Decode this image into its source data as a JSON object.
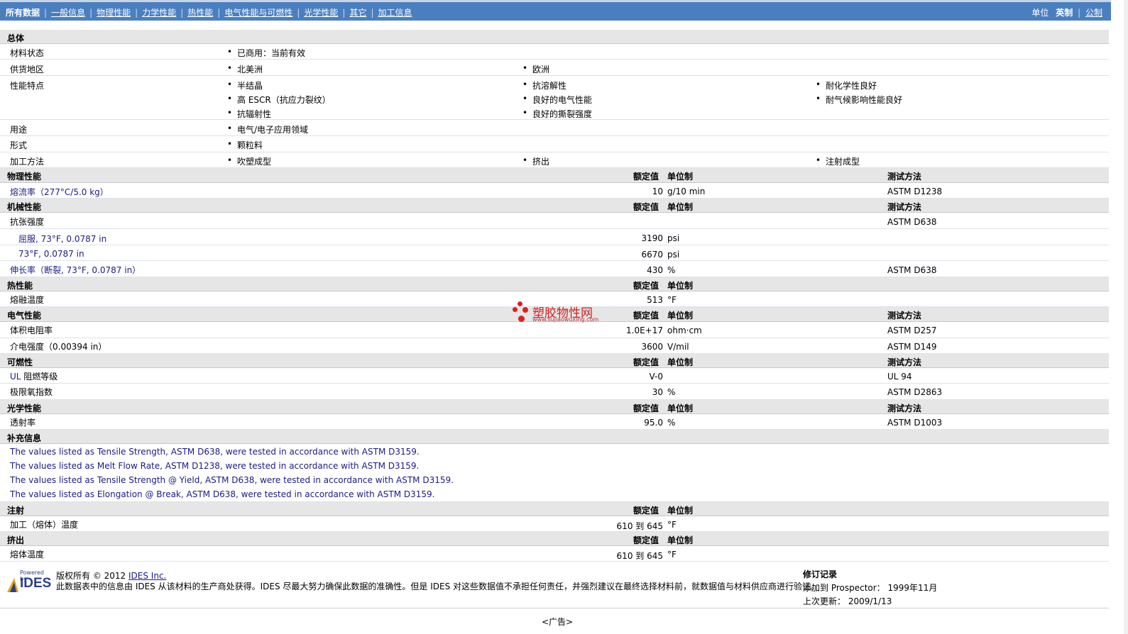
{
  "nav": {
    "tabs": [
      "所有数据",
      "一般信息",
      "物理性能",
      "力学性能",
      "热性能",
      "电气性能与可燃性",
      "光学性能",
      "其它",
      "加工信息"
    ],
    "units_label": "单位",
    "unit_english": "英制",
    "unit_metric": "公制"
  },
  "general": {
    "title": "总体",
    "status_label": "材料状态",
    "status_value": "已商用：当前有效",
    "region_label": "供货地区",
    "region_values": [
      "北美洲",
      "欧洲"
    ],
    "features_label": "性能特点",
    "features": [
      "半结晶",
      "抗溶解性",
      "耐化学性良好",
      "高 ESCR（抗应力裂纹）",
      "良好的电气性能",
      "耐气候影响性能良好",
      "抗辐射性",
      "良好的撕裂强度"
    ],
    "use_label": "用途",
    "use_value": "电气/电子应用领域",
    "form_label": "形式",
    "form_value": "颗粒料",
    "process_label": "加工方法",
    "process_values": [
      "吹塑成型",
      "挤出",
      "注射成型"
    ]
  },
  "headers": {
    "nominal": "额定值",
    "unit": "单位制",
    "method": "测试方法"
  },
  "physical": {
    "title": "物理性能",
    "rows": [
      {
        "label": "熔流率（277°C/5.0 kg）",
        "value": "10",
        "unit": "g/10 min",
        "method": "ASTM D1238"
      }
    ]
  },
  "mechanical": {
    "title": "机械性能",
    "tensile_label": "抗张强度",
    "tensile_method": "ASTM D638",
    "rows": [
      {
        "label": "屈服, 73°F, 0.0787 in",
        "value": "3190",
        "unit": "psi"
      },
      {
        "label": "73°F, 0.0787 in",
        "value": "6670",
        "unit": "psi"
      }
    ],
    "elong": {
      "label": "伸长率（断裂, 73°F, 0.0787 in）",
      "value": "430",
      "unit": "%",
      "method": "ASTM D638"
    }
  },
  "thermal": {
    "title": "热性能",
    "rows": [
      {
        "label": "熔融温度",
        "value": "513",
        "unit": "°F"
      }
    ]
  },
  "electrical": {
    "title": "电气性能",
    "rows": [
      {
        "label": "体积电阻率",
        "value": "1.0E+17",
        "unit": "ohm·cm",
        "method": "ASTM D257"
      },
      {
        "label": "介电强度（0.00394 in）",
        "value": "3600",
        "unit": "V/mil",
        "method": "ASTM D149"
      }
    ]
  },
  "flammability": {
    "title": "可燃性",
    "ul_prefix": "UL",
    "rows": [
      {
        "label": "阻燃等级",
        "value": "V-0",
        "unit": "",
        "method": "UL 94"
      },
      {
        "label": "极限氧指数",
        "value": "30",
        "unit": "%",
        "method": "ASTM D2863"
      }
    ]
  },
  "optical": {
    "title": "光学性能",
    "rows": [
      {
        "label": "透射率",
        "value": "95.0",
        "unit": "%",
        "method": "ASTM D1003"
      }
    ]
  },
  "supplement": {
    "title": "补充信息",
    "notes": [
      "The values listed as Tensile Strength, ASTM D638, were tested in accordance with ASTM D3159.",
      "The values listed as Melt Flow Rate, ASTM D1238, were tested in accordance with ASTM D3159.",
      "The values listed as Tensile Strength @ Yield, ASTM D638, were tested in accordance with ASTM D3159.",
      "The values listed as Elongation @ Break, ASTM D638, were tested in accordance with ASTM D3159."
    ]
  },
  "injection": {
    "title": "注射",
    "rows": [
      {
        "label": "加工（熔体）温度",
        "value": "610 到  645",
        "unit": "°F"
      }
    ]
  },
  "extrusion": {
    "title": "挤出",
    "rows": [
      {
        "label": "熔体温度",
        "value": "610 到  645",
        "unit": "°F"
      }
    ]
  },
  "watermark": {
    "cn": "塑胶物性网",
    "url": "www.sujiaowuxing.com"
  },
  "footer": {
    "powered": "Powered by",
    "logo": "IDES",
    "copyright_prefix": "版权所有  © 2012",
    "company": "IDES Inc.",
    "disclaimer": "此数据表中的信息由  IDES 从该材料的生产商处获得。IDES 尽最大努力确保此数据的准确性。但是  IDES 对这些数据值不承担任何责任，并强烈建议在最终选择材料前，就数据值与材料供应商进行验证。",
    "rev_title": "修订记录",
    "added_label": "添加到  Prospector：",
    "added_value": "1999年11月",
    "updated_label": "上次更新：",
    "updated_value": "2009/1/13",
    "ad": "<广告>"
  },
  "colors": {
    "nav": "#4a7fbf",
    "section": "#e6e6e6",
    "text_blue": "#1a1a8a",
    "watermark": "#e02020"
  }
}
